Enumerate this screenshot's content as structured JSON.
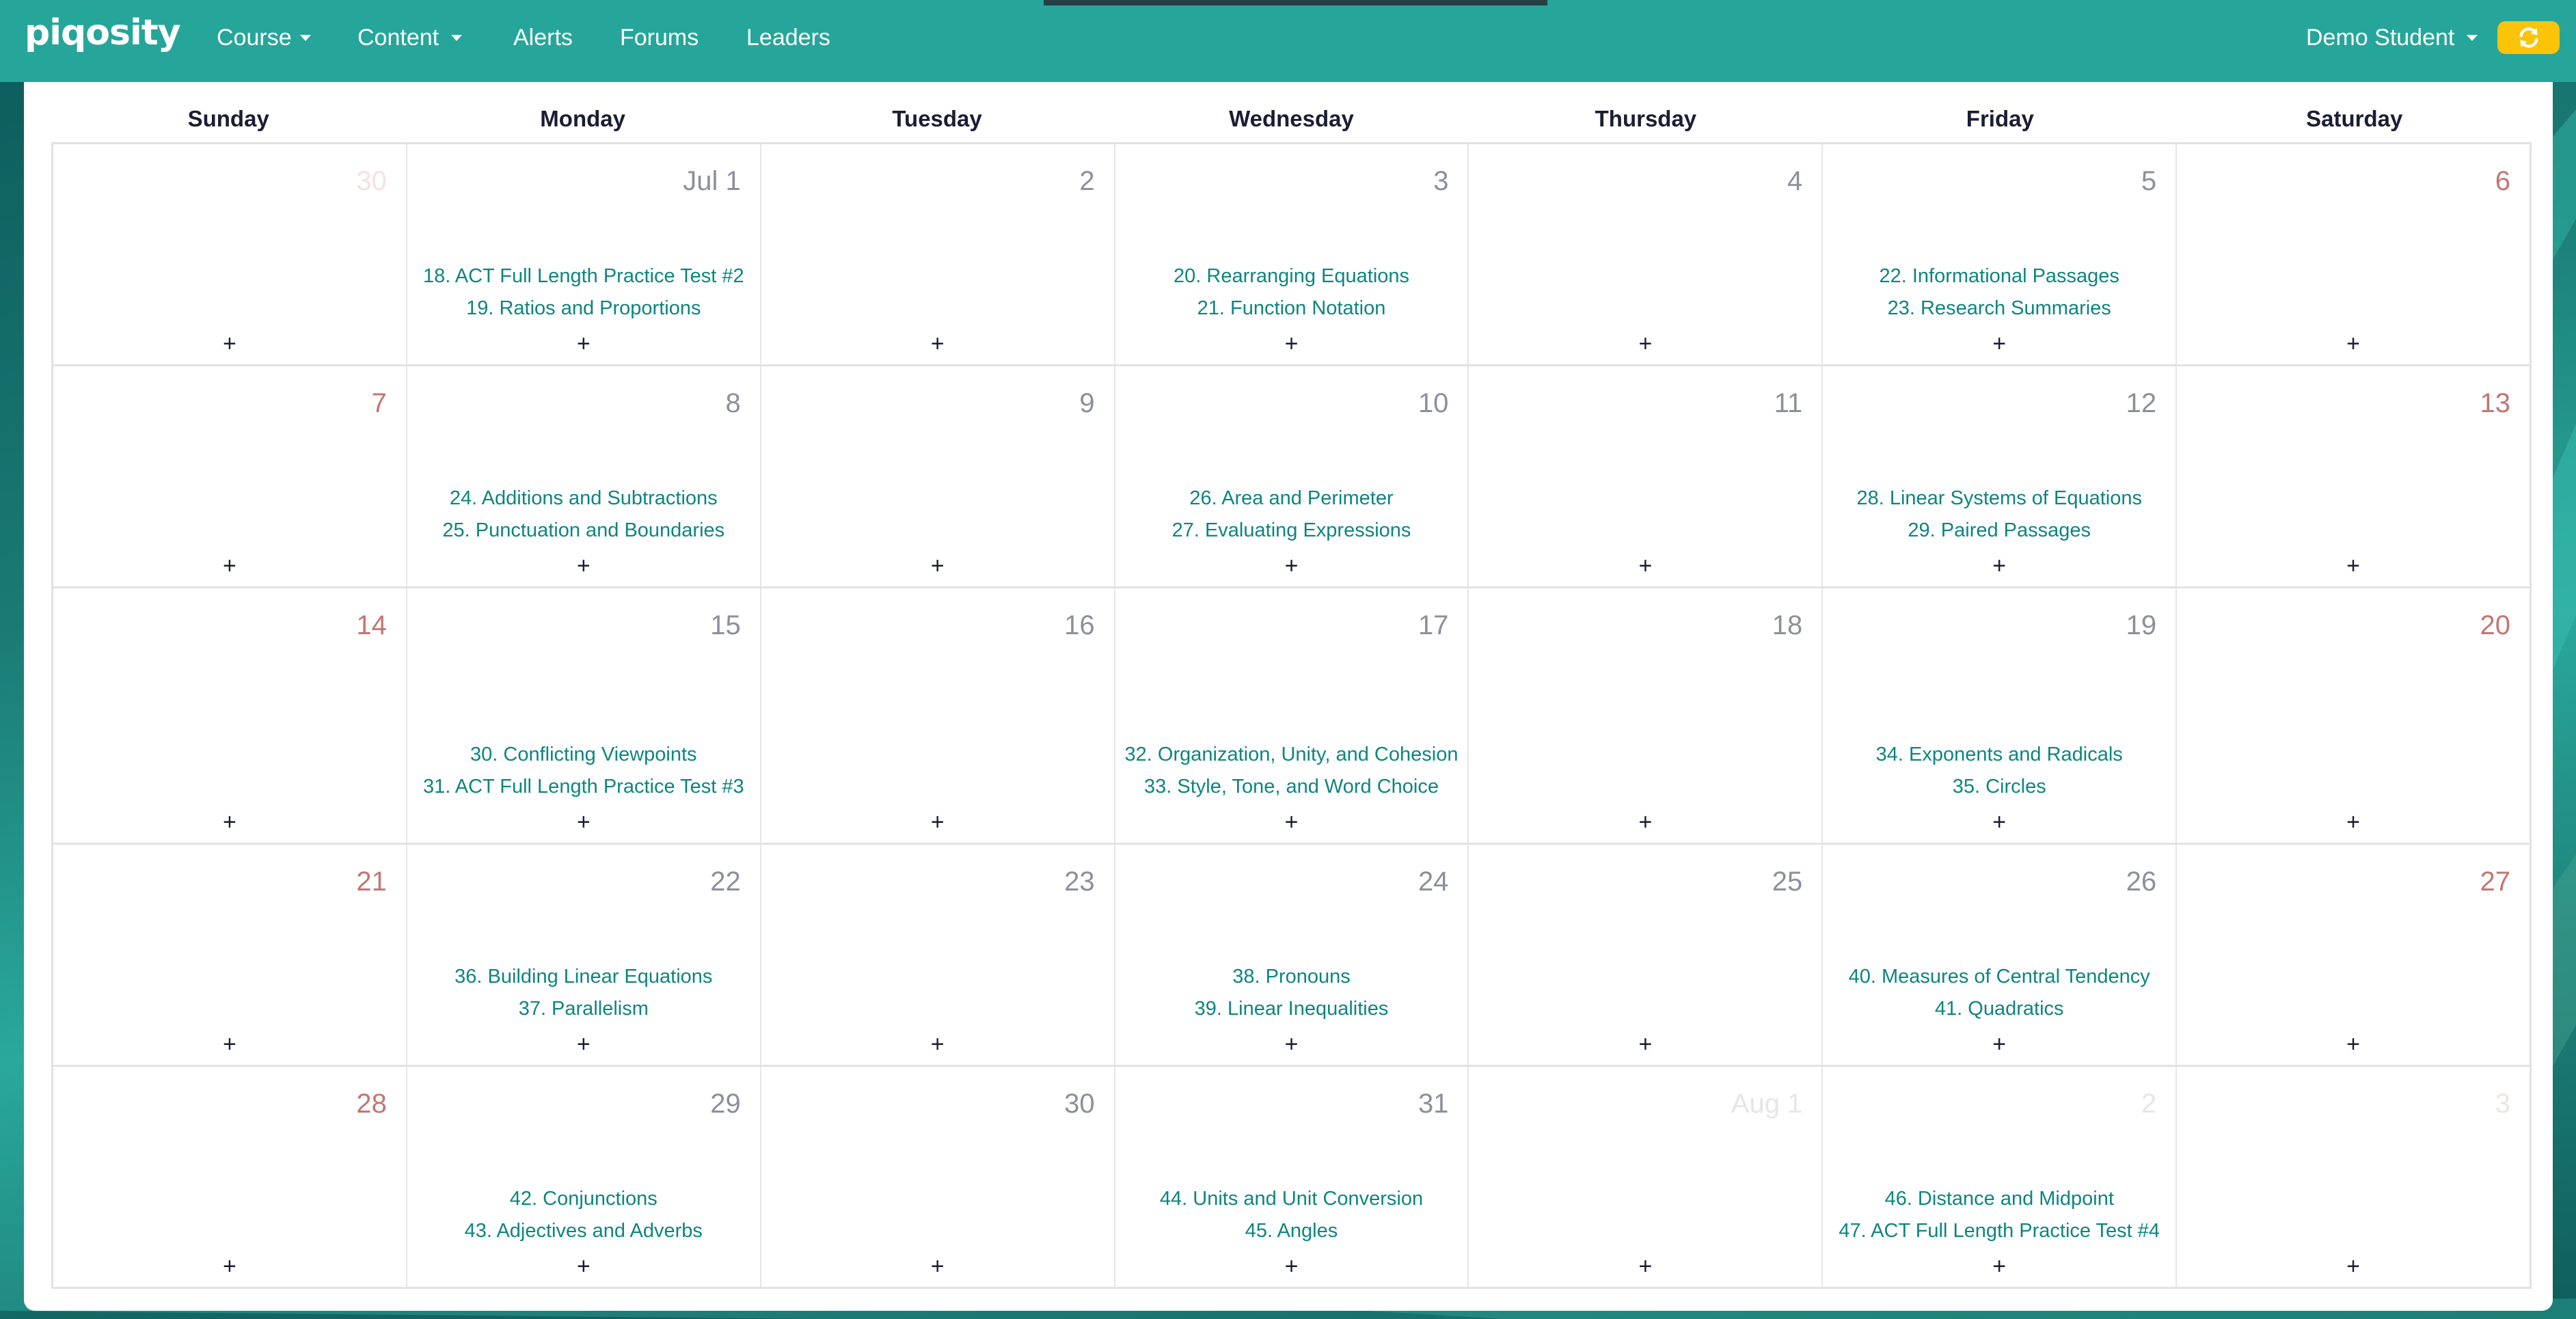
{
  "navbar": {
    "brand": "piqosity",
    "items": [
      {
        "label": "Course",
        "dropdown": true
      },
      {
        "label": "Content",
        "dropdown": true
      },
      {
        "label": "Alerts",
        "dropdown": false
      },
      {
        "label": "Forums",
        "dropdown": false
      },
      {
        "label": "Leaders",
        "dropdown": false
      }
    ],
    "user": {
      "label": "Demo Student",
      "dropdown": true
    },
    "sync_button": {
      "icon": "sync-icon",
      "color": "#fbc409"
    }
  },
  "colors": {
    "navbar": "#26a69a",
    "event_link": "#0d8580",
    "weekend_day": "#c27672",
    "weekday_day": "#8d8f9c",
    "sync_button": "#fbc409"
  },
  "calendar": {
    "weekdays": [
      "Sunday",
      "Monday",
      "Tuesday",
      "Wednesday",
      "Thursday",
      "Friday",
      "Saturday"
    ],
    "add_label": "+",
    "weeks": [
      [
        {
          "label": "30",
          "other_month": true,
          "weekend": true,
          "events": []
        },
        {
          "label": "Jul 1",
          "other_month": false,
          "weekend": false,
          "events": [
            "18. ACT Full Length Practice Test #2",
            "19. Ratios and Proportions"
          ]
        },
        {
          "label": "2",
          "other_month": false,
          "weekend": false,
          "events": []
        },
        {
          "label": "3",
          "other_month": false,
          "weekend": false,
          "events": [
            "20. Rearranging Equations",
            "21. Function Notation"
          ]
        },
        {
          "label": "4",
          "other_month": false,
          "weekend": false,
          "events": []
        },
        {
          "label": "5",
          "other_month": false,
          "weekend": false,
          "events": [
            "22. Informational Passages",
            "23. Research Summaries"
          ]
        },
        {
          "label": "6",
          "other_month": false,
          "weekend": true,
          "events": []
        }
      ],
      [
        {
          "label": "7",
          "other_month": false,
          "weekend": true,
          "events": []
        },
        {
          "label": "8",
          "other_month": false,
          "weekend": false,
          "events": [
            "24. Additions and Subtractions",
            "25. Punctuation and Boundaries"
          ]
        },
        {
          "label": "9",
          "other_month": false,
          "weekend": false,
          "events": []
        },
        {
          "label": "10",
          "other_month": false,
          "weekend": false,
          "events": [
            "26. Area and Perimeter",
            "27. Evaluating Expressions"
          ]
        },
        {
          "label": "11",
          "other_month": false,
          "weekend": false,
          "events": []
        },
        {
          "label": "12",
          "other_month": false,
          "weekend": false,
          "events": [
            "28. Linear Systems of Equations",
            "29. Paired Passages"
          ]
        },
        {
          "label": "13",
          "other_month": false,
          "weekend": true,
          "events": []
        }
      ],
      [
        {
          "label": "14",
          "other_month": false,
          "weekend": true,
          "events": []
        },
        {
          "label": "15",
          "other_month": false,
          "weekend": false,
          "events": [
            "30. Conflicting Viewpoints",
            "31. ACT Full Length Practice Test #3"
          ]
        },
        {
          "label": "16",
          "other_month": false,
          "weekend": false,
          "events": []
        },
        {
          "label": "17",
          "other_month": false,
          "weekend": false,
          "events": [
            "32. Organization, Unity, and Cohesion",
            "33. Style, Tone, and Word Choice"
          ]
        },
        {
          "label": "18",
          "other_month": false,
          "weekend": false,
          "events": []
        },
        {
          "label": "19",
          "other_month": false,
          "weekend": false,
          "events": [
            "34. Exponents and Radicals",
            "35. Circles"
          ]
        },
        {
          "label": "20",
          "other_month": false,
          "weekend": true,
          "events": []
        }
      ],
      [
        {
          "label": "21",
          "other_month": false,
          "weekend": true,
          "events": []
        },
        {
          "label": "22",
          "other_month": false,
          "weekend": false,
          "events": [
            "36. Building Linear Equations",
            "37. Parallelism"
          ]
        },
        {
          "label": "23",
          "other_month": false,
          "weekend": false,
          "events": []
        },
        {
          "label": "24",
          "other_month": false,
          "weekend": false,
          "events": [
            "38. Pronouns",
            "39. Linear Inequalities"
          ]
        },
        {
          "label": "25",
          "other_month": false,
          "weekend": false,
          "events": []
        },
        {
          "label": "26",
          "other_month": false,
          "weekend": false,
          "events": [
            "40. Measures of Central Tendency",
            "41. Quadratics"
          ]
        },
        {
          "label": "27",
          "other_month": false,
          "weekend": true,
          "events": []
        }
      ],
      [
        {
          "label": "28",
          "other_month": false,
          "weekend": true,
          "events": []
        },
        {
          "label": "29",
          "other_month": false,
          "weekend": false,
          "events": [
            "42. Conjunctions",
            "43. Adjectives and Adverbs"
          ]
        },
        {
          "label": "30",
          "other_month": false,
          "weekend": false,
          "events": []
        },
        {
          "label": "31",
          "other_month": false,
          "weekend": false,
          "events": [
            "44. Units and Unit Conversion",
            "45. Angles"
          ]
        },
        {
          "label": "Aug 1",
          "other_month": true,
          "weekend": false,
          "events": []
        },
        {
          "label": "2",
          "other_month": true,
          "weekend": false,
          "events": [
            "46. Distance and Midpoint",
            "47. ACT Full Length Practice Test #4"
          ]
        },
        {
          "label": "3",
          "other_month": true,
          "weekend": true,
          "events": []
        }
      ]
    ]
  }
}
